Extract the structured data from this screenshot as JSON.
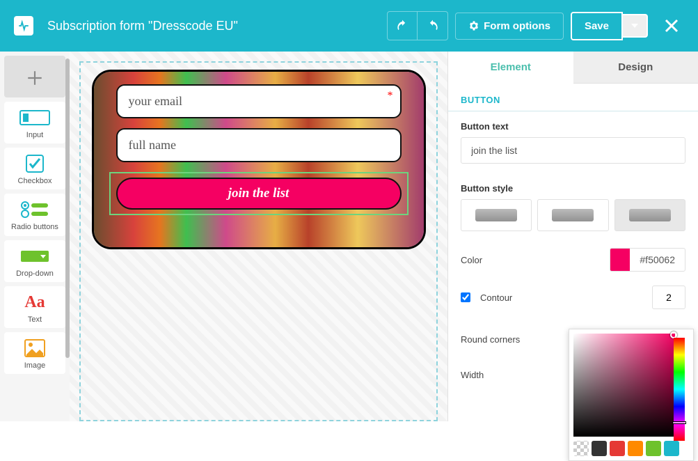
{
  "header": {
    "title": "Subscription form \"Dresscode EU\"",
    "form_options": "Form options",
    "save": "Save"
  },
  "sidebar": {
    "items": [
      {
        "label": "Input"
      },
      {
        "label": "Checkbox"
      },
      {
        "label": "Radio buttons"
      },
      {
        "label": "Drop-down"
      },
      {
        "label": "Text"
      },
      {
        "label": "Image"
      }
    ]
  },
  "form": {
    "email_placeholder": "your email",
    "name_placeholder": "full name",
    "button_label": "join the list"
  },
  "panel": {
    "tabs": {
      "element": "Element",
      "design": "Design"
    },
    "section": "BUTTON",
    "button_text_label": "Button text",
    "button_text_value": "join the list",
    "button_style_label": "Button style",
    "color_label": "Color",
    "color_value": "#f50062",
    "contour_label": "Contour",
    "contour_value": "2",
    "round_label": "Round corners",
    "width_label": "Width"
  },
  "picker_swatches": [
    "#fff",
    "#333",
    "#e53935",
    "#ff8a00",
    "#6ec22c",
    "#1cb7cb"
  ]
}
